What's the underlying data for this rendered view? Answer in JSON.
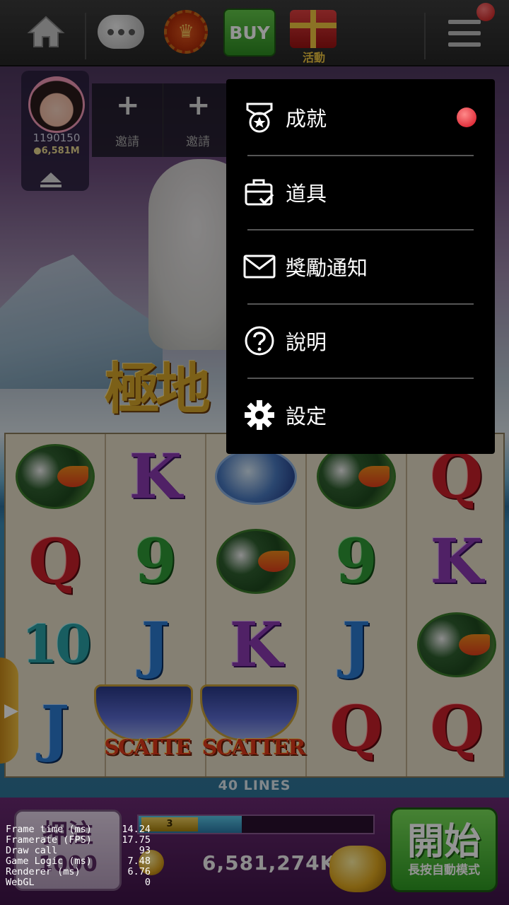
{
  "topbar": {
    "buy_label": "BUY",
    "event_label": "活動",
    "icons": [
      "home-icon",
      "chat-icon",
      "badge-icon",
      "gift-icon",
      "menu-icon"
    ]
  },
  "player": {
    "id": "1190150",
    "coins": "●6,581M",
    "invite_labels": [
      "邀請",
      "邀請"
    ]
  },
  "game": {
    "logo": "極地",
    "reels": [
      [
        "puffin",
        "Q",
        "10",
        "J"
      ],
      [
        "K",
        "9",
        "J",
        "scatter"
      ],
      [
        "dolphin",
        "puffin",
        "K",
        "scatter"
      ],
      [
        "puffin",
        "9",
        "J",
        "Q"
      ],
      [
        "Q",
        "K",
        "puffin",
        "Q"
      ]
    ],
    "scatter_labels": [
      "SCATTE",
      "SCATTER"
    ],
    "lines_label": "40 LINES"
  },
  "bottom": {
    "bet_label": "押注",
    "bet_value": "1000",
    "level": "3",
    "level_progress": 0.44,
    "balance": "6,581,274K",
    "spin_label": "開始",
    "spin_sub": "長按自動模式"
  },
  "stats": [
    {
      "label": "Frame time (ms)",
      "value": "14.24"
    },
    {
      "label": "Framerate (FPS)",
      "value": "17.75"
    },
    {
      "label": "Draw call",
      "value": "93"
    },
    {
      "label": "Game Logic (ms)",
      "value": "7.48"
    },
    {
      "label": "Renderer (ms)",
      "value": "6.76"
    },
    {
      "label": "WebGL",
      "value": "0"
    }
  ],
  "menu": {
    "items": [
      {
        "label": "成就",
        "icon": "medal-icon",
        "has_alert": true
      },
      {
        "label": "道具",
        "icon": "briefcase-icon",
        "has_alert": false
      },
      {
        "label": "獎勵通知",
        "icon": "mail-icon",
        "has_alert": false
      },
      {
        "label": "說明",
        "icon": "help-icon",
        "has_alert": false
      },
      {
        "label": "設定",
        "icon": "gear-icon",
        "has_alert": false
      }
    ]
  },
  "colors": {
    "menu_bg": "#000000",
    "alert_red": "#d40e1e",
    "spin_green": "#2e9a22",
    "buy_green": "#2e8d22"
  }
}
